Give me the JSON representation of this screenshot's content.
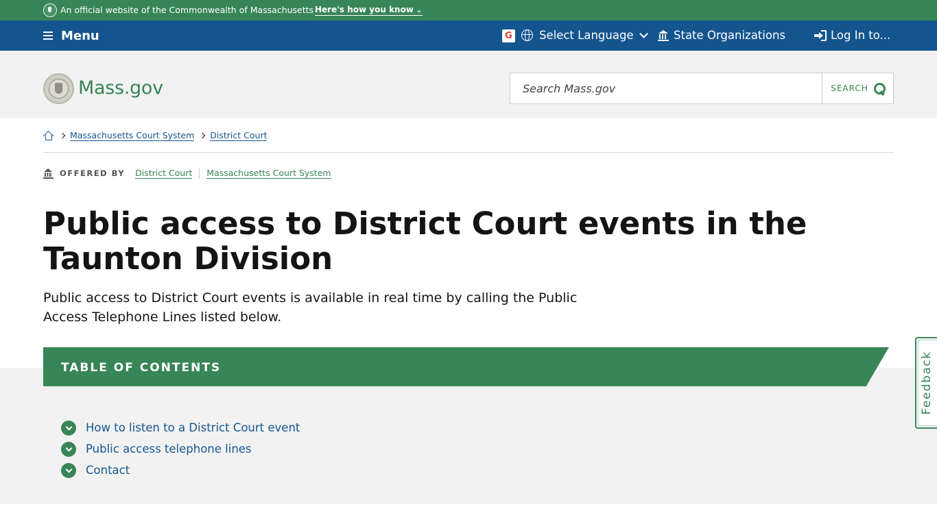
{
  "official_banner": {
    "text": "An official website of the Commonwealth of Massachusetts",
    "how_link": "Here's how you know"
  },
  "utility_nav": {
    "menu_label": "Menu",
    "language_label": "Select Language",
    "state_orgs_label": "State Organizations",
    "login_label": "Log In to..."
  },
  "header": {
    "brand": "Mass.gov",
    "search_placeholder": "Search Mass.gov",
    "search_button": "SEARCH"
  },
  "breadcrumb": {
    "items": [
      "Massachusetts Court System",
      "District Court"
    ]
  },
  "offered_by": {
    "label": "OFFERED BY",
    "orgs": [
      "District Court",
      "Massachusetts Court System"
    ]
  },
  "page": {
    "title": "Public access to District Court events in the Taunton Division",
    "lede": "Public access to District Court events is available in real time by calling the Public Access Telephone Lines listed below."
  },
  "toc": {
    "title": "TABLE OF CONTENTS",
    "items": [
      "How to listen to a District Court event",
      "Public access telephone lines",
      "Contact"
    ]
  },
  "feedback": {
    "label": "Feedback"
  },
  "colors": {
    "brand_green": "#388557",
    "nav_blue": "#14558f",
    "link_blue": "#14558f",
    "header_gray": "#f2f2f2"
  },
  "icons": {
    "official_seal": "ma-seal-icon",
    "menu": "hamburger-icon",
    "google": "google-translate-icon",
    "language": "globe-icon",
    "state_orgs": "building-icon",
    "login": "login-icon",
    "search": "search-icon",
    "home": "home-icon",
    "toc_bullet": "chevron-down-circle-icon"
  }
}
